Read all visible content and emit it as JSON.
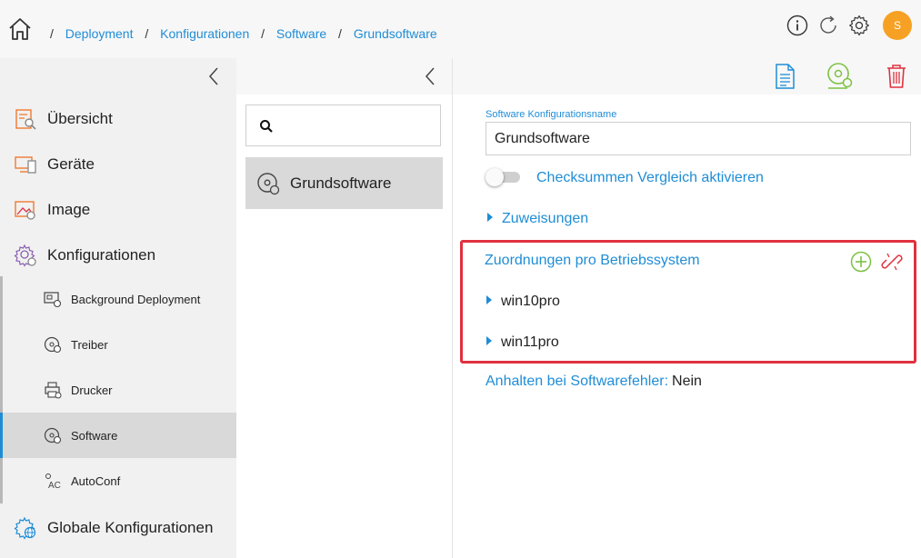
{
  "breadcrumb": {
    "items": [
      {
        "label": "Deployment"
      },
      {
        "label": "Konfigurationen"
      },
      {
        "label": "Software"
      },
      {
        "label": "Grundsoftware"
      }
    ],
    "separator": "/"
  },
  "header": {
    "icons": [
      "info-icon",
      "refresh-icon",
      "settings-icon"
    ],
    "avatar_initial": "S",
    "avatar_color": "#f7a124"
  },
  "sidebar": {
    "items": [
      {
        "label": "Übersicht",
        "icon": "overview-icon"
      },
      {
        "label": "Geräte",
        "icon": "devices-icon"
      },
      {
        "label": "Image",
        "icon": "image-icon"
      },
      {
        "label": "Konfigurationen",
        "icon": "configurations-icon"
      },
      {
        "label": "Globale Konfigurationen",
        "icon": "global-config-icon"
      }
    ],
    "subitems": [
      {
        "label": "Background Deployment",
        "icon": "background-deployment-icon"
      },
      {
        "label": "Treiber",
        "icon": "driver-disc-icon"
      },
      {
        "label": "Drucker",
        "icon": "printer-icon"
      },
      {
        "label": "Software",
        "icon": "software-disc-icon",
        "active": true
      },
      {
        "label": "AutoConf",
        "icon": "autoconf-icon"
      }
    ]
  },
  "list_panel": {
    "search_placeholder": "",
    "items": [
      {
        "label": "Grundsoftware",
        "selected": true
      }
    ]
  },
  "detail": {
    "name_label": "Software Konfigurationsname",
    "name_value": "Grundsoftware",
    "checksum_toggle_label": "Checksummen Vergleich aktivieren",
    "checksum_toggle_on": false,
    "assignments_label": "Zuweisungen",
    "os_section_title": "Zuordnungen pro Betriebssystem",
    "os_items": [
      "win10pro",
      "win11pro"
    ],
    "stop_on_error_label": "Anhalten bei Softwarefehler:",
    "stop_on_error_value": "Nein"
  },
  "colors": {
    "accent": "#1f8dd6",
    "highlight_border": "#e0313f",
    "add_green": "#7cc142",
    "delete_red": "#e0313f",
    "icon_orange": "#f07a30"
  }
}
